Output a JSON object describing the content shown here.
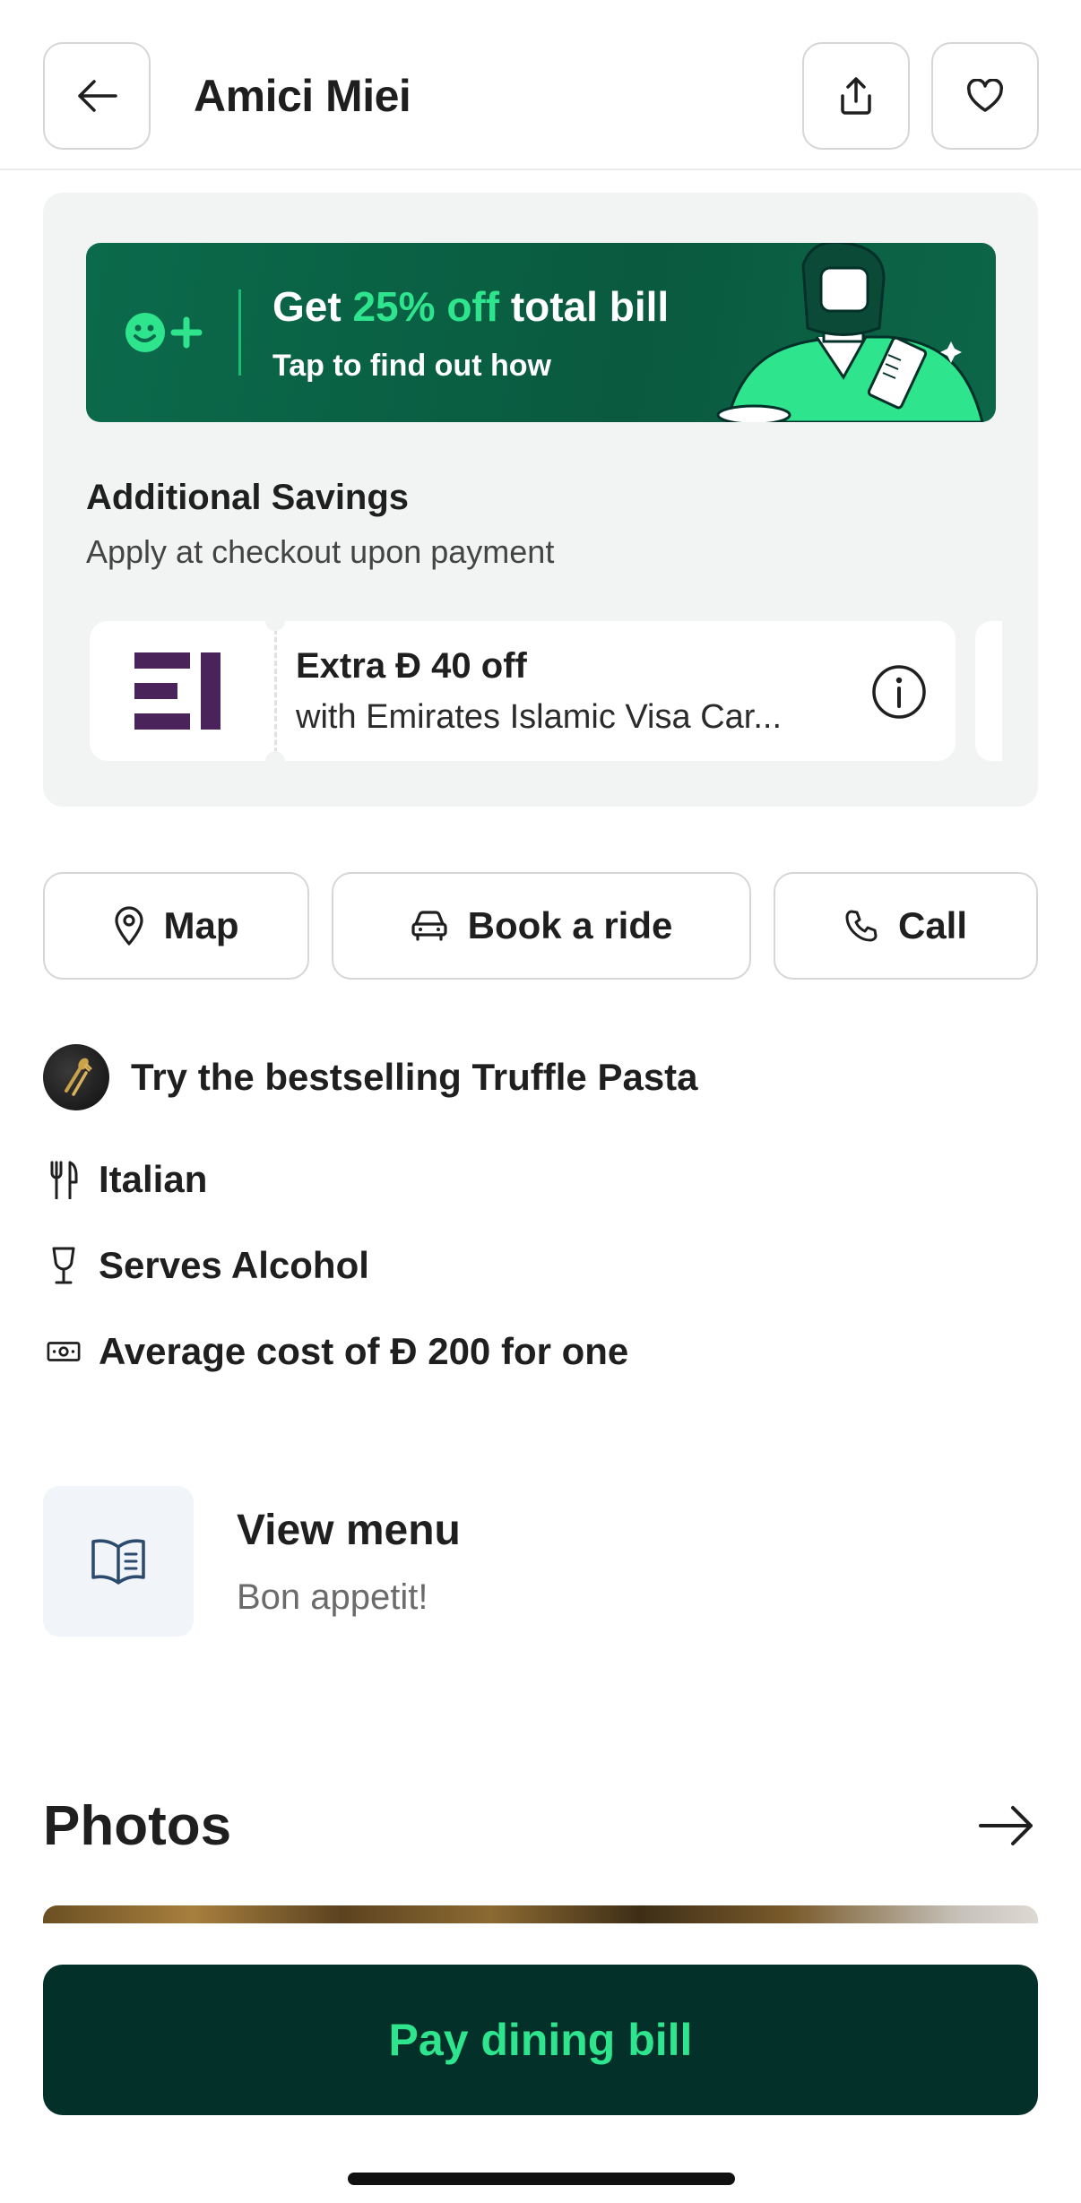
{
  "header": {
    "title": "Amici Miei",
    "back_icon": "arrow-left-icon",
    "share_icon": "share-icon",
    "favorite_icon": "heart-icon"
  },
  "promo": {
    "title_prefix": "Get ",
    "title_highlight": "25% off",
    "title_suffix": " total bill",
    "subtitle": "Tap to find out how",
    "accent_color": "#2ee58e",
    "background_color": "#0b6a4b"
  },
  "savings": {
    "title": "Additional Savings",
    "subtitle": "Apply at checkout upon payment",
    "coupon": {
      "title": "Extra Ð 40 off",
      "subtitle": "with Emirates Islamic Visa Car...",
      "logo_icon": "emirates-islamic-logo-icon",
      "info_icon": "info-icon"
    }
  },
  "actions": {
    "map_label": "Map",
    "ride_label": "Book a ride",
    "call_label": "Call"
  },
  "bestseller": {
    "text": "Try the bestselling Truffle Pasta"
  },
  "details": {
    "cuisine": "Italian",
    "alcohol": "Serves Alcohol",
    "cost": "Average cost of Ð 200 for one"
  },
  "menu": {
    "title": "View menu",
    "subtitle": "Bon appetit!"
  },
  "photos": {
    "title": "Photos"
  },
  "cta": {
    "label": "Pay dining bill",
    "background_color": "#04302a",
    "text_color": "#2ee58e"
  }
}
